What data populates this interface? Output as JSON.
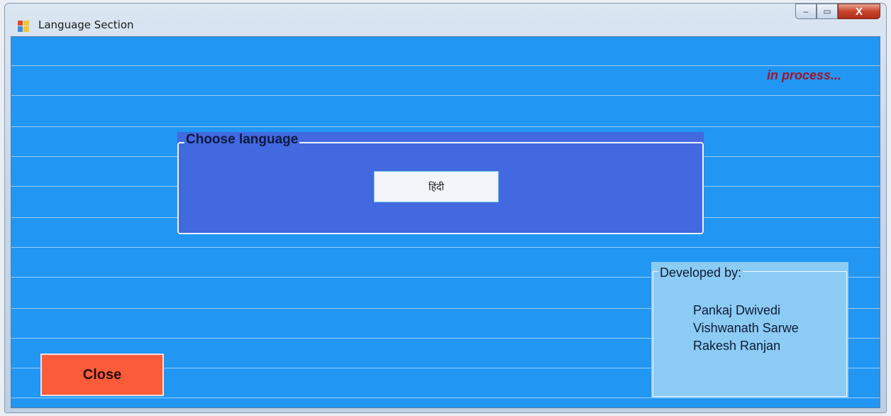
{
  "window": {
    "title": "Language Section",
    "controls": {
      "minimize": "–",
      "maximize": "▭",
      "close": "X"
    }
  },
  "status": {
    "text": "in process..."
  },
  "language_group": {
    "legend": "Choose language",
    "hindi_button": "हिंदी"
  },
  "developers_group": {
    "legend": "Developed by:",
    "names": [
      "Pankaj Dwivedi",
      "Vishwanath Sarwe",
      "Rakesh Ranjan"
    ]
  },
  "close_button": {
    "label": "Close"
  },
  "colors": {
    "client_background": "#2196f3",
    "language_group_background": "#4369e0",
    "developers_group_background": "#8ccbf4",
    "close_button_background": "#fa5c3a",
    "status_text": "#a4142a"
  }
}
